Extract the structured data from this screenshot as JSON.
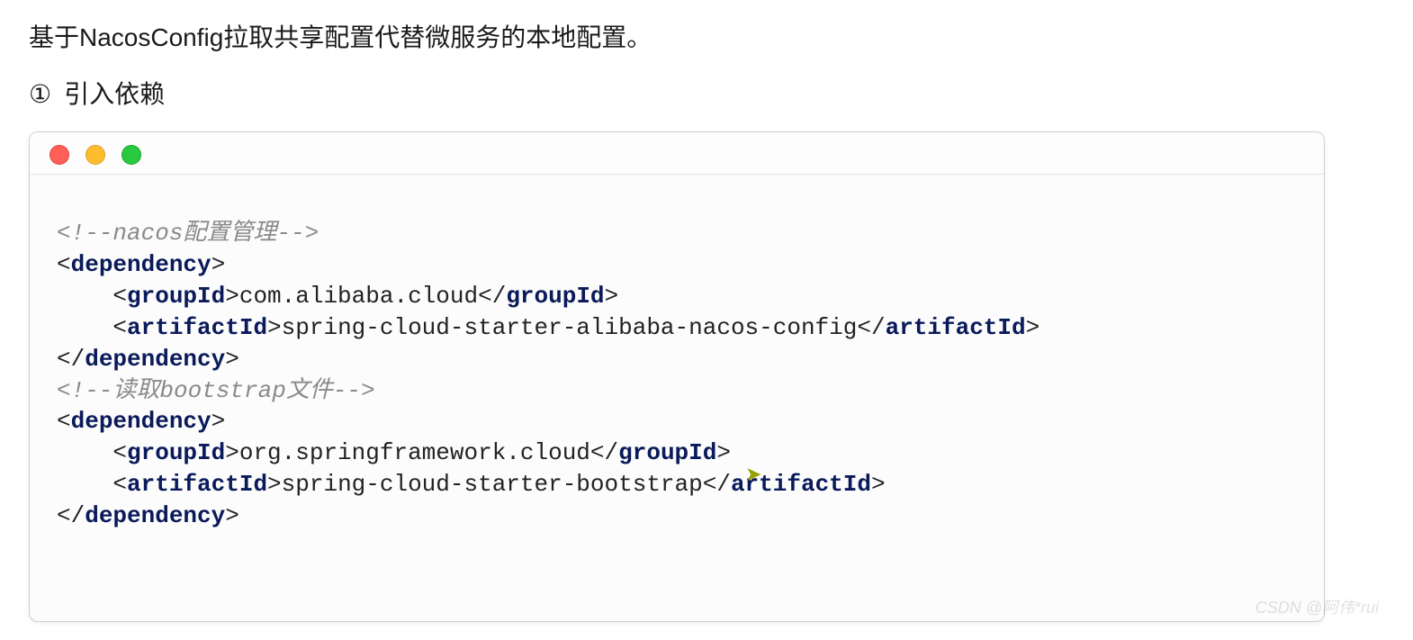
{
  "intro": "基于NacosConfig拉取共享配置代替微服务的本地配置。",
  "step": {
    "num": "①",
    "title": "引入依赖"
  },
  "window": {
    "dots": {
      "red": "#ff5f57",
      "yellow": "#febc2e",
      "green": "#28c840"
    }
  },
  "code": {
    "comment1": "<!--nacos配置管理-->",
    "dep1": {
      "open": "dependency",
      "groupId_tag": "groupId",
      "groupId_val": "com.alibaba.cloud",
      "artifactId_tag": "artifactId",
      "artifactId_val": "spring-cloud-starter-alibaba-nacos-config",
      "close": "dependency"
    },
    "comment2": "<!--读取bootstrap文件-->",
    "dep2": {
      "open": "dependency",
      "groupId_tag": "groupId",
      "groupId_val": "org.springframework.cloud",
      "artifactId_tag": "artifactId",
      "artifactId_val": "spring-cloud-starter-bootstrap",
      "close": "dependency"
    }
  },
  "watermark": "CSDN @阿伟*rui"
}
